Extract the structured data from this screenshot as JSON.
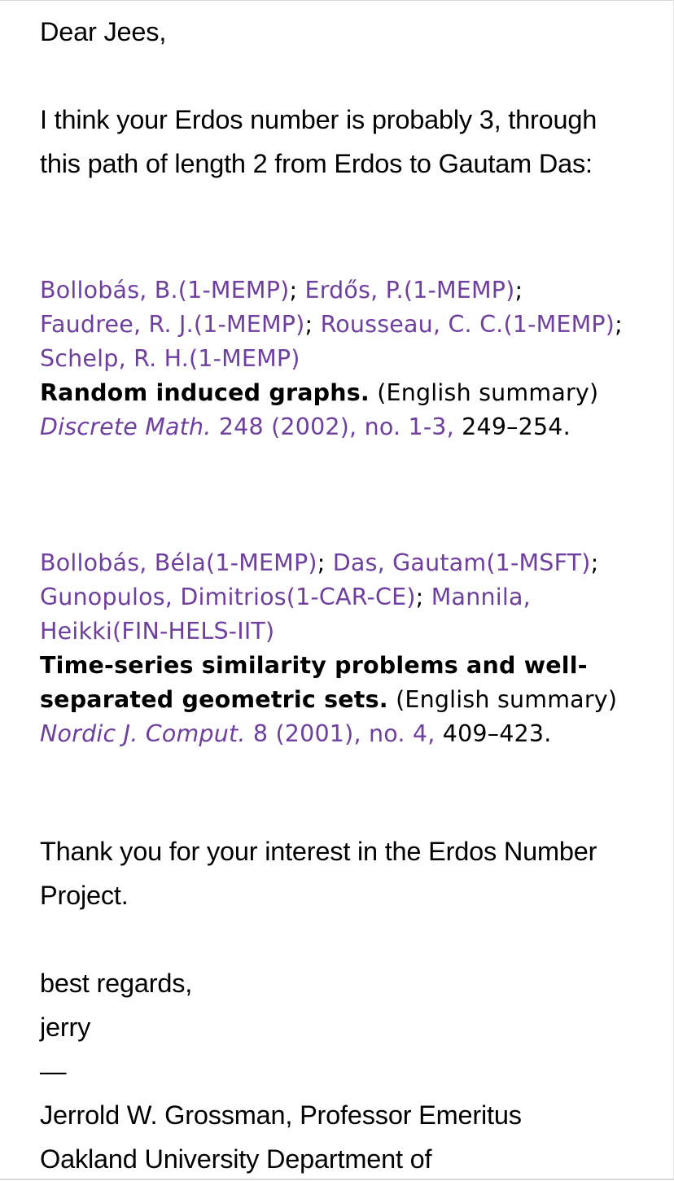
{
  "greeting": "Dear Jees,",
  "intro": "I think your Erdos number is probably 3, through this path of length 2 from Erdos to Gautam Das:",
  "references": [
    {
      "authors": [
        "Bollobás, B.(1-MEMP)",
        "Erdős, P.(1-MEMP)",
        "Faudree, R. J.(1-MEMP)",
        "Rousseau, C. C.(1-MEMP)",
        "Schelp, R. H.(1-MEMP)"
      ],
      "title": "Random induced graphs.",
      "note": "(English summary)",
      "journal": "Discrete Math.",
      "volume": "248 (2002), no. 1-3,",
      "pages": "249–254."
    },
    {
      "authors": [
        "Bollobás, Béla(1-MEMP)",
        "Das, Gautam(1-MSFT)",
        "Gunopulos, Dimitrios(1-CAR-CE)",
        "Mannila, Heikki(FIN-HELS-IIT)"
      ],
      "title": "Time-series similarity problems and well-separated geometric sets.",
      "note": "(English summary)",
      "journal": "Nordic J. Comput.",
      "volume": "8 (2001), no. 4,",
      "pages": "409–423."
    }
  ],
  "separator": ";",
  "thanks": "Thank you for your interest in the Erdos Number Project.",
  "closing": "best regards,",
  "signature": {
    "name": "jerry",
    "dash": "—",
    "line1": "Jerrold W. Grossman, Professor Emeritus",
    "line2": "Oakland University Department of"
  },
  "colors": {
    "link": "#6f3fa0",
    "text": "#000000",
    "background": "#ffffff"
  }
}
